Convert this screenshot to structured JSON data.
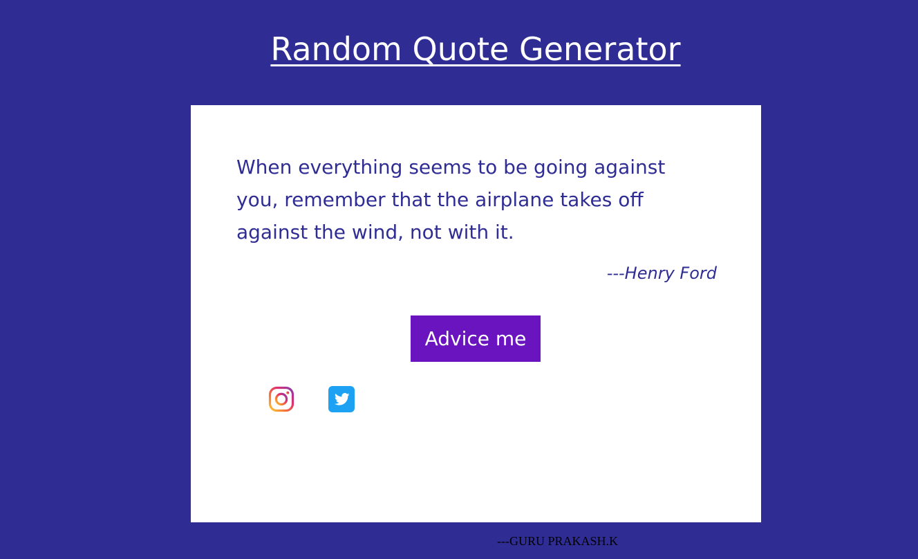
{
  "page": {
    "title": "Random Quote Generator",
    "background_color": "#2f2d93"
  },
  "quote_card": {
    "text": "When everything seems to be going against you, remember that the airplane takes off against the wind, not with it.",
    "author": "---Henry Ford",
    "text_color": "#2f2d93"
  },
  "advice_button": {
    "label": "Advice me",
    "color": "#6a14c0"
  },
  "social": {
    "icons": [
      "instagram-icon",
      "twitter-icon"
    ],
    "twitter_color": "#1da1f2"
  },
  "footer": {
    "credit": "---GURU PRAKASH.K"
  }
}
